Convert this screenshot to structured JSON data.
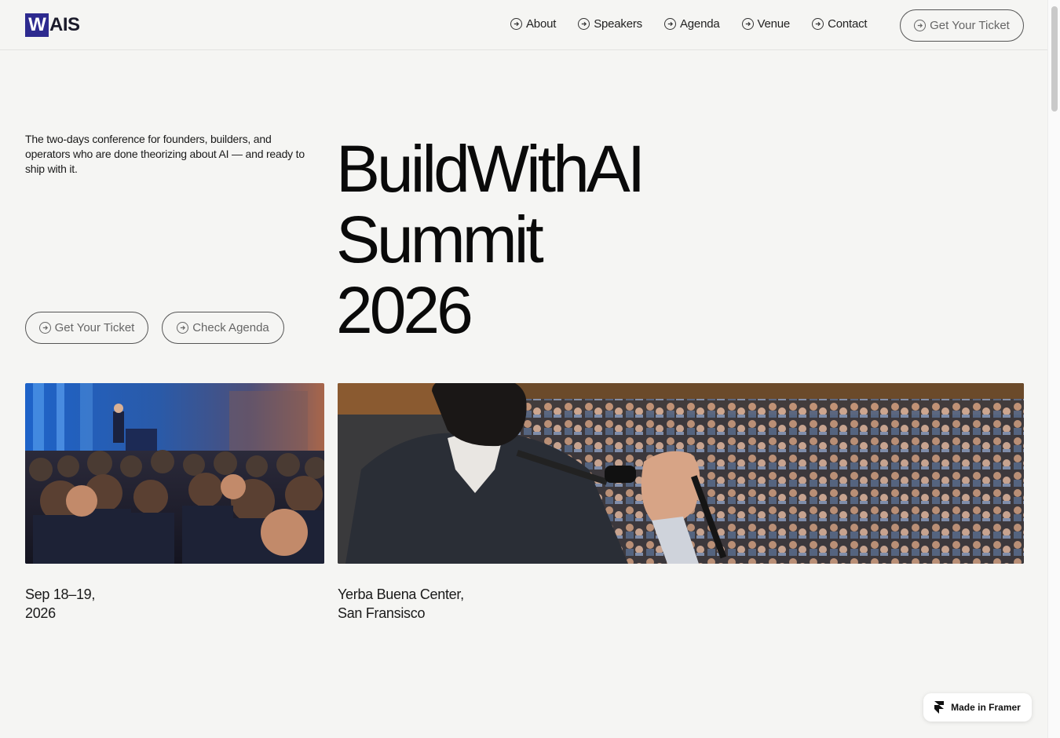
{
  "header": {
    "logo_mark": "W",
    "logo_text": "AIS",
    "nav": [
      "About",
      "Speakers",
      "Agenda",
      "Venue",
      "Contact"
    ],
    "cta_label": "Get Your Ticket"
  },
  "hero": {
    "intro": "The two-days conference for founders, builders, and operators who are done theorizing about AI — and ready to ship with it.",
    "title_lines": [
      "BuildWithAI",
      "Summit",
      "2026"
    ],
    "buttons": {
      "ticket": "Get Your Ticket",
      "agenda": "Check Agenda"
    }
  },
  "details": {
    "date": "Sep 18–19,\n2026",
    "venue": "Yerba Buena Center,\nSan Fransisco"
  },
  "badge": {
    "label": "Made in Framer"
  },
  "colors": {
    "background": "#f5f5f3",
    "logo_accent": "#2d2a8f",
    "text": "#111111"
  },
  "icons": {
    "nav_arrow": "circle-arrow-right-icon",
    "badge": "framer-icon"
  }
}
